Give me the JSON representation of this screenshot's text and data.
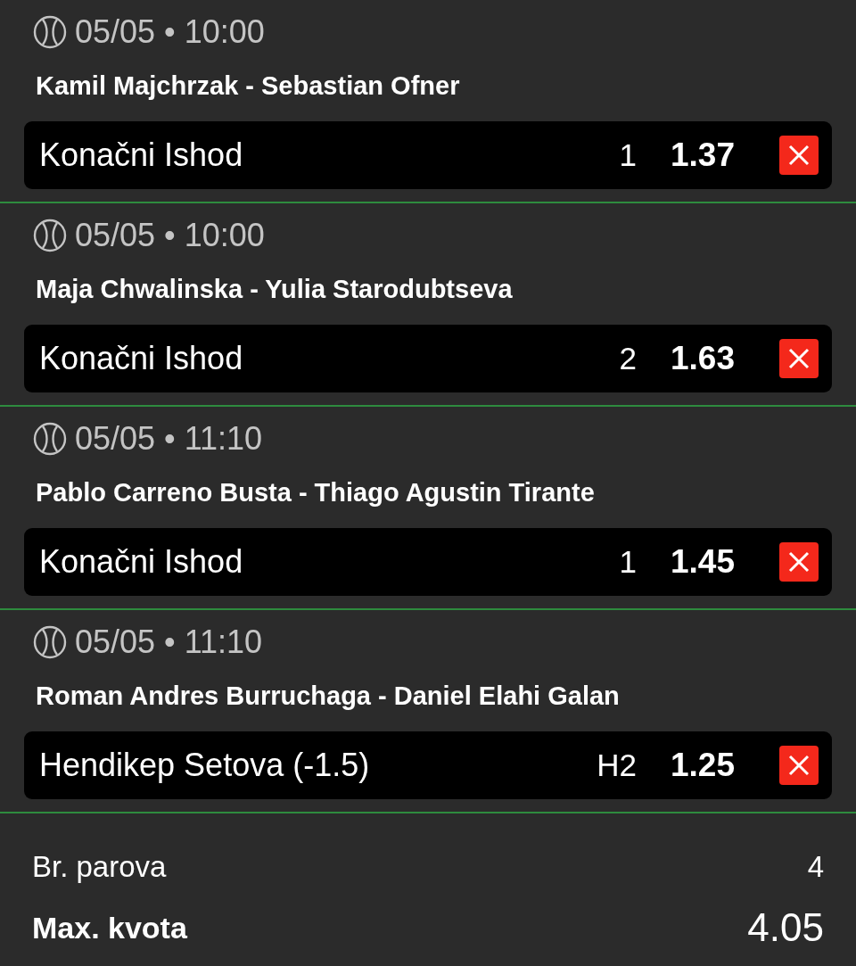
{
  "bets": [
    {
      "datetime": "05/05 • 10:00",
      "match": "Kamil Majchrzak - Sebastian Ofner",
      "market": "Konačni Ishod",
      "pick": "1",
      "odds": "1.37"
    },
    {
      "datetime": "05/05 • 10:00",
      "match": "Maja Chwalinska - Yulia Starodubtseva",
      "market": "Konačni Ishod",
      "pick": "2",
      "odds": "1.63"
    },
    {
      "datetime": "05/05 • 11:10",
      "match": "Pablo Carreno Busta - Thiago Agustin Tirante",
      "market": "Konačni Ishod",
      "pick": "1",
      "odds": "1.45"
    },
    {
      "datetime": "05/05 • 11:10",
      "match": "Roman Andres Burruchaga - Daniel Elahi Galan",
      "market": "Hendikep Setova (-1.5)",
      "pick": "H2",
      "odds": "1.25"
    }
  ],
  "summary": {
    "pairs_label": "Br. parova",
    "pairs_value": "4",
    "max_odds_label": "Max. kvota",
    "max_odds_value": "4.05"
  }
}
